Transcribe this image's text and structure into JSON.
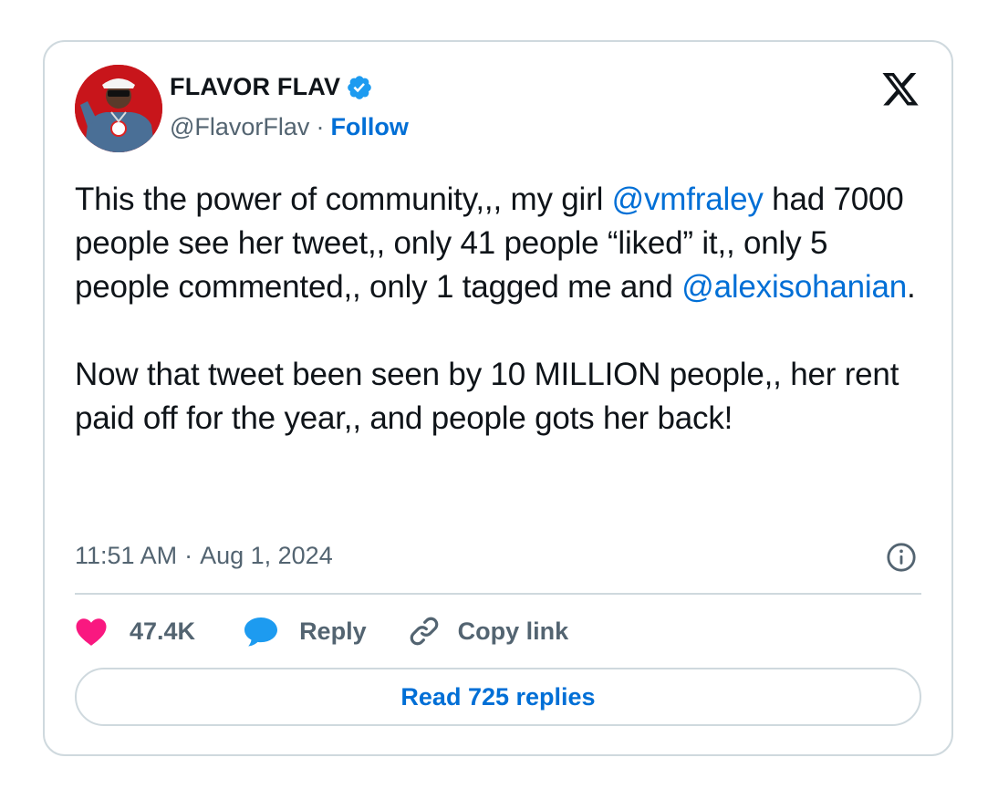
{
  "author": {
    "display_name": "FLAVOR FLAV",
    "handle": "@FlavorFlav",
    "separator": "·",
    "follow_label": "Follow"
  },
  "tweet": {
    "line1_pre": "This the power of community,,, my girl ",
    "mention1": "@vmfraley",
    "line1_post": " had 7000 people see her tweet,, only 41 people “liked” it,, only 5 people commented,, only 1 tagged me and ",
    "mention2": "@alexisohanian",
    "line1_end": ".",
    "para2": "Now that tweet been seen by 10 MILLION people,, her rent paid off for the year,, and people gots her back!"
  },
  "meta": {
    "time": "11:51 AM",
    "separator": "·",
    "date": "Aug 1, 2024"
  },
  "actions": {
    "likes": "47.4K",
    "reply_label": "Reply",
    "copy_label": "Copy link"
  },
  "read_replies_label": "Read 725 replies",
  "colors": {
    "link": "#006fd6",
    "like": "#f91880",
    "reply_icon": "#1d9bf0",
    "verified": "#1d9bf0",
    "muted": "#536471",
    "border": "#cfd9de"
  },
  "icons": {
    "verified": "verified-badge-icon",
    "x_logo": "x-logo-icon",
    "info": "info-icon",
    "like": "heart-icon",
    "reply": "speech-bubble-icon",
    "copy": "link-icon"
  }
}
